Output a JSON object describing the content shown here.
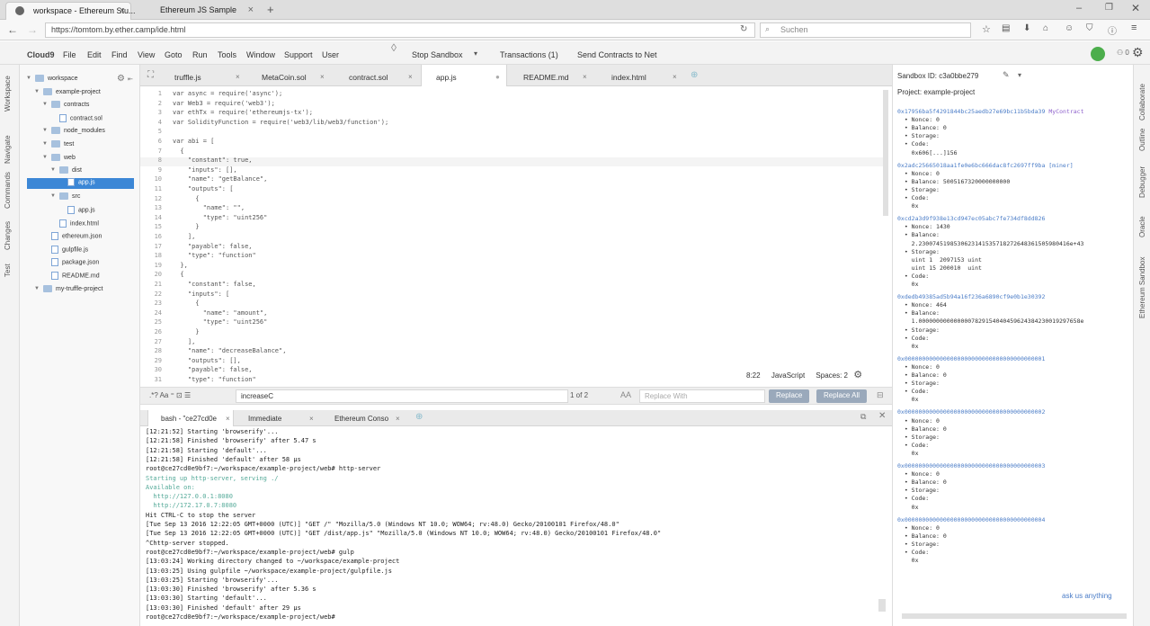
{
  "browser": {
    "tabs": [
      {
        "label": "workspace - Ethereum Stu..."
      },
      {
        "label": "Ethereum JS Sample"
      }
    ],
    "url": "https://tomtom.by.ether.camp/ide.html",
    "search_placeholder": "Suchen"
  },
  "menu": {
    "logo": "Cloud9",
    "items": [
      "File",
      "Edit",
      "Find",
      "View",
      "Goto",
      "Run",
      "Tools",
      "Window",
      "Support",
      "User"
    ],
    "stop_sandbox": "Stop Sandbox",
    "transactions": "Transactions (1)",
    "send_contracts": "Send Contracts to Net"
  },
  "left_rail": [
    "Workspace",
    "Navigate",
    "Commands",
    "Changes",
    "Test"
  ],
  "right_rail": [
    "Collaborate",
    "Outline",
    "Debugger",
    "Oracle",
    "Ethereum Sandbox"
  ],
  "tree": [
    {
      "label": "workspace",
      "depth": 0,
      "kind": "folder"
    },
    {
      "label": "example-project",
      "depth": 1,
      "kind": "folder"
    },
    {
      "label": "contracts",
      "depth": 2,
      "kind": "folder"
    },
    {
      "label": "contract.sol",
      "depth": 3,
      "kind": "file"
    },
    {
      "label": "node_modules",
      "depth": 2,
      "kind": "folder"
    },
    {
      "label": "test",
      "depth": 2,
      "kind": "folder"
    },
    {
      "label": "web",
      "depth": 2,
      "kind": "folder"
    },
    {
      "label": "dist",
      "depth": 3,
      "kind": "folder"
    },
    {
      "label": "app.js",
      "depth": 4,
      "kind": "file",
      "selected": true
    },
    {
      "label": "src",
      "depth": 3,
      "kind": "folder"
    },
    {
      "label": "app.js",
      "depth": 4,
      "kind": "file"
    },
    {
      "label": "index.html",
      "depth": 3,
      "kind": "file"
    },
    {
      "label": "ethereum.json",
      "depth": 2,
      "kind": "file"
    },
    {
      "label": "gulpfile.js",
      "depth": 2,
      "kind": "file"
    },
    {
      "label": "package.json",
      "depth": 2,
      "kind": "file"
    },
    {
      "label": "README.md",
      "depth": 2,
      "kind": "file"
    },
    {
      "label": "my-truffle-project",
      "depth": 1,
      "kind": "folder"
    }
  ],
  "editor_tabs": [
    "truffle.js",
    "MetaCoin.sol",
    "contract.sol",
    "app.js",
    "README.md",
    "index.html"
  ],
  "code": [
    "var async = require('async');",
    "var Web3 = require('web3');",
    "var ethTx = require('ethereumjs-tx');",
    "var SolidityFunction = require('web3/lib/web3/function');",
    "",
    "var abi = [",
    "  {",
    "    \"constant\": true,",
    "    \"inputs\": [],",
    "    \"name\": \"getBalance\",",
    "    \"outputs\": [",
    "      {",
    "        \"name\": \"\",",
    "        \"type\": \"uint256\"",
    "      }",
    "    ],",
    "    \"payable\": false,",
    "    \"type\": \"function\"",
    "  },",
    "  {",
    "    \"constant\": false,",
    "    \"inputs\": [",
    "      {",
    "        \"name\": \"amount\",",
    "        \"type\": \"uint256\"",
    "      }",
    "    ],",
    "    \"name\": \"decreaseBalance\",",
    "    \"outputs\": [],",
    "    \"payable\": false,",
    "    \"type\": \"function\""
  ],
  "editor_status": {
    "position": "8:22",
    "language": "JavaScript",
    "spaces": "Spaces: 2"
  },
  "find": {
    "query": "increaseC",
    "count": "1 of 2",
    "replace_placeholder": "Replace With",
    "replace": "Replace",
    "replace_all": "Replace All",
    "aa": "AA"
  },
  "terminal_tabs": [
    "bash - \"ce27cd0e",
    "Immediate",
    "Ethereum Conso"
  ],
  "terminal": [
    "[12:21:52] Starting 'browserify'...",
    "[12:21:58] Finished 'browserify' after 5.47 s",
    "[12:21:58] Starting 'default'...",
    "[12:21:58] Finished 'default' after 58 μs",
    "root@ce27cd0e9bf7:~/workspace/example-project/web# http-server",
    "Starting up http-server, serving ./",
    "Available on:",
    "  http://127.0.0.1:8080",
    "  http://172.17.0.7:8080",
    "Hit CTRL-C to stop the server",
    "[Tue Sep 13 2016 12:22:05 GMT+0000 (UTC)] \"GET /\" \"Mozilla/5.0 (Windows NT 10.0; WOW64; rv:48.0) Gecko/20100101 Firefox/48.0\"",
    "[Tue Sep 13 2016 12:22:05 GMT+0000 (UTC)] \"GET /dist/app.js\" \"Mozilla/5.0 (Windows NT 10.0; WOW64; rv:48.0) Gecko/20100101 Firefox/48.0\"",
    "^Chttp-server stopped.",
    "root@ce27cd0e9bf7:~/workspace/example-project/web# gulp",
    "[13:03:24] Working directory changed to ~/workspace/example-project",
    "[13:03:25] Using gulpfile ~/workspace/example-project/gulpfile.js",
    "[13:03:25] Starting 'browserify'...",
    "[13:03:30] Finished 'browserify' after 5.36 s",
    "[13:03:30] Starting 'default'...",
    "[13:03:30] Finished 'default' after 29 μs",
    "root@ce27cd0e9bf7:~/workspace/example-project/web# "
  ],
  "sandbox": {
    "id_label": "Sandbox ID: c3a0bbe279",
    "project": "Project: example-project",
    "ask": "ask us anything",
    "lines": [
      {
        "t": "0x17956ba5f4291844bc25aedb27e69bc11b5bda39",
        "k": "addr",
        "extra": "MyContract"
      },
      {
        "t": "  • Nonce: 0"
      },
      {
        "t": "  • Balance: 0"
      },
      {
        "t": "  • Storage:"
      },
      {
        "t": "  • Code:"
      },
      {
        "t": "    0x606[...]156"
      },
      {
        "t": "0x2adc25665018aa1fe0e6bc666dac8fc2697ff9ba [miner]",
        "k": "addr"
      },
      {
        "t": "  • Nonce: 0"
      },
      {
        "t": "  • Balance: 5005167320000000000"
      },
      {
        "t": "  • Storage:"
      },
      {
        "t": "  • Code:"
      },
      {
        "t": "    0x"
      },
      {
        "t": "0xcd2a3d9f938e13cd947ec05abc7fe734df8dd826",
        "k": "addr"
      },
      {
        "t": "  • Nonce: 1430"
      },
      {
        "t": "  • Balance:"
      },
      {
        "t": "    2.2300745198530623141535718272648361505980416e+43"
      },
      {
        "t": "  • Storage:"
      },
      {
        "t": "    uint 1  2097153 uint"
      },
      {
        "t": "    uint 15 200010  uint"
      },
      {
        "t": "  • Code:"
      },
      {
        "t": "    0x"
      },
      {
        "t": "0xdedb49385ad5b94a16f236a6890cf9e0b1e30392",
        "k": "addr"
      },
      {
        "t": "  • Nonce: 464"
      },
      {
        "t": "  • Balance:"
      },
      {
        "t": "    1.0000000000000007829154040459624384230019297658e"
      },
      {
        "t": "  • Storage:"
      },
      {
        "t": "  • Code:"
      },
      {
        "t": "    0x"
      },
      {
        "t": "0x0000000000000000000000000000000000000001",
        "k": "addr"
      },
      {
        "t": "  • Nonce: 0"
      },
      {
        "t": "  • Balance: 0"
      },
      {
        "t": "  • Storage:"
      },
      {
        "t": "  • Code:"
      },
      {
        "t": "    0x"
      },
      {
        "t": "0x0000000000000000000000000000000000000002",
        "k": "addr"
      },
      {
        "t": "  • Nonce: 0"
      },
      {
        "t": "  • Balance: 0"
      },
      {
        "t": "  • Storage:"
      },
      {
        "t": "  • Code:"
      },
      {
        "t": "    0x"
      },
      {
        "t": "0x0000000000000000000000000000000000000003",
        "k": "addr"
      },
      {
        "t": "  • Nonce: 0"
      },
      {
        "t": "  • Balance: 0"
      },
      {
        "t": "  • Storage:"
      },
      {
        "t": "  • Code:"
      },
      {
        "t": "    0x"
      },
      {
        "t": "0x0000000000000000000000000000000000000004",
        "k": "addr"
      },
      {
        "t": "  • Nonce: 0"
      },
      {
        "t": "  • Balance: 0"
      },
      {
        "t": "  • Storage:"
      },
      {
        "t": "  • Code:"
      },
      {
        "t": "    0x"
      }
    ]
  }
}
